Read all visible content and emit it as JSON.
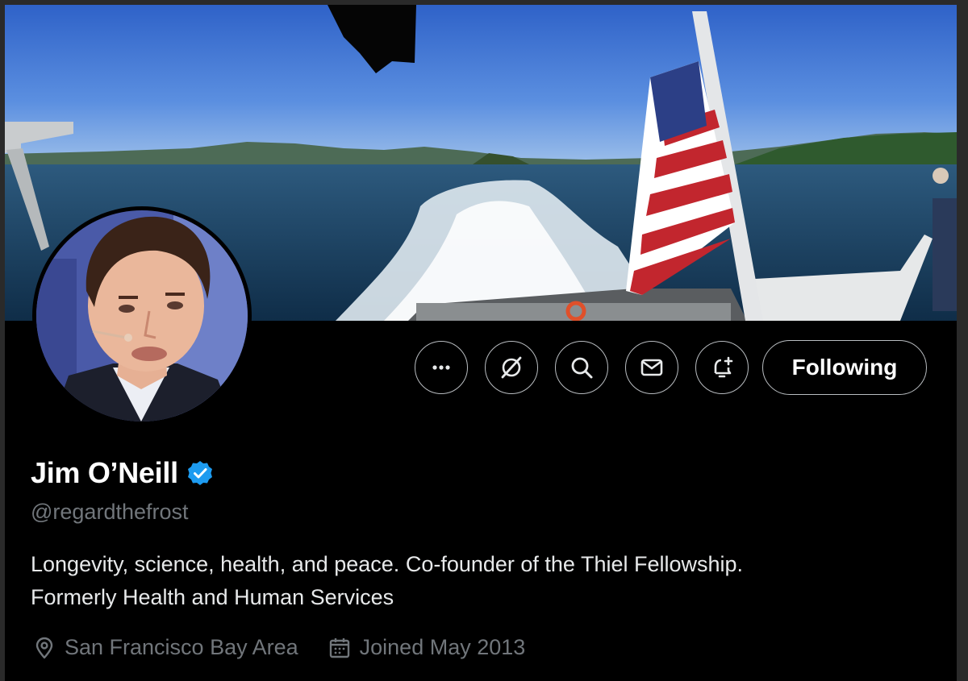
{
  "profile": {
    "display_name": "Jim O’Neill",
    "verified_badge": "verified-badge-icon",
    "handle": "@regardthefrost",
    "bio_lines": [
      "Longevity, science, health, and peace. Co-founder of the Thiel Fellowship.",
      "Formerly Health and Human Services"
    ],
    "location": "San Francisco Bay Area",
    "joined": "Joined May 2013"
  },
  "actions": {
    "more_icon": "more-icon",
    "grok_icon": "grok-icon",
    "search_icon": "search-icon",
    "message_icon": "message-icon",
    "notify_icon": "bell-plus-icon",
    "follow_label": "Following"
  },
  "colors": {
    "background": "#000000",
    "verified": "#1d9bf0",
    "secondary_text": "#71767b",
    "button_border": "#b9bdc1"
  }
}
